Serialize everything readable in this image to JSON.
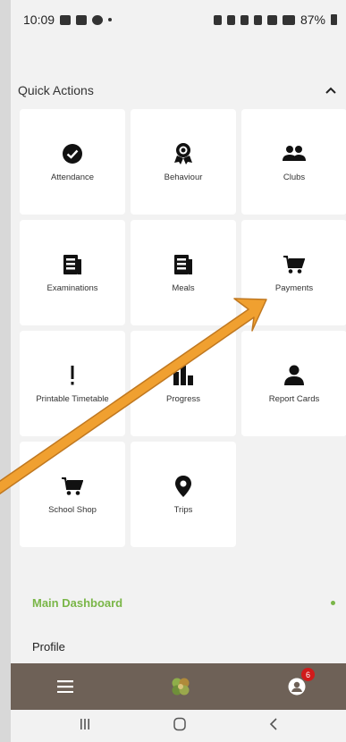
{
  "status_bar": {
    "time": "10:09",
    "battery": "87%"
  },
  "quick_actions": {
    "title": "Quick Actions",
    "tiles": [
      {
        "label": "Attendance",
        "icon": "check-circle-icon"
      },
      {
        "label": "Behaviour",
        "icon": "award-ribbon-icon"
      },
      {
        "label": "Clubs",
        "icon": "group-icon"
      },
      {
        "label": "Examinations",
        "icon": "document-icon"
      },
      {
        "label": "Meals",
        "icon": "document-icon"
      },
      {
        "label": "Payments",
        "icon": "cart-icon"
      },
      {
        "label": "Printable Timetable",
        "icon": "exclamation-icon"
      },
      {
        "label": "Progress",
        "icon": "bar-chart-icon"
      },
      {
        "label": "Report Cards",
        "icon": "person-icon"
      },
      {
        "label": "School Shop",
        "icon": "cart-icon"
      },
      {
        "label": "Trips",
        "icon": "location-pin-icon"
      }
    ]
  },
  "menu": {
    "main_dashboard": "Main Dashboard",
    "profile": "Profile"
  },
  "bottom_bar": {
    "notification_count": "6"
  },
  "colors": {
    "accent_green": "#7ab648",
    "bottom_bar": "#6e6157",
    "badge_red": "#d11b1b",
    "annotation_arrow": "#f0a030"
  }
}
